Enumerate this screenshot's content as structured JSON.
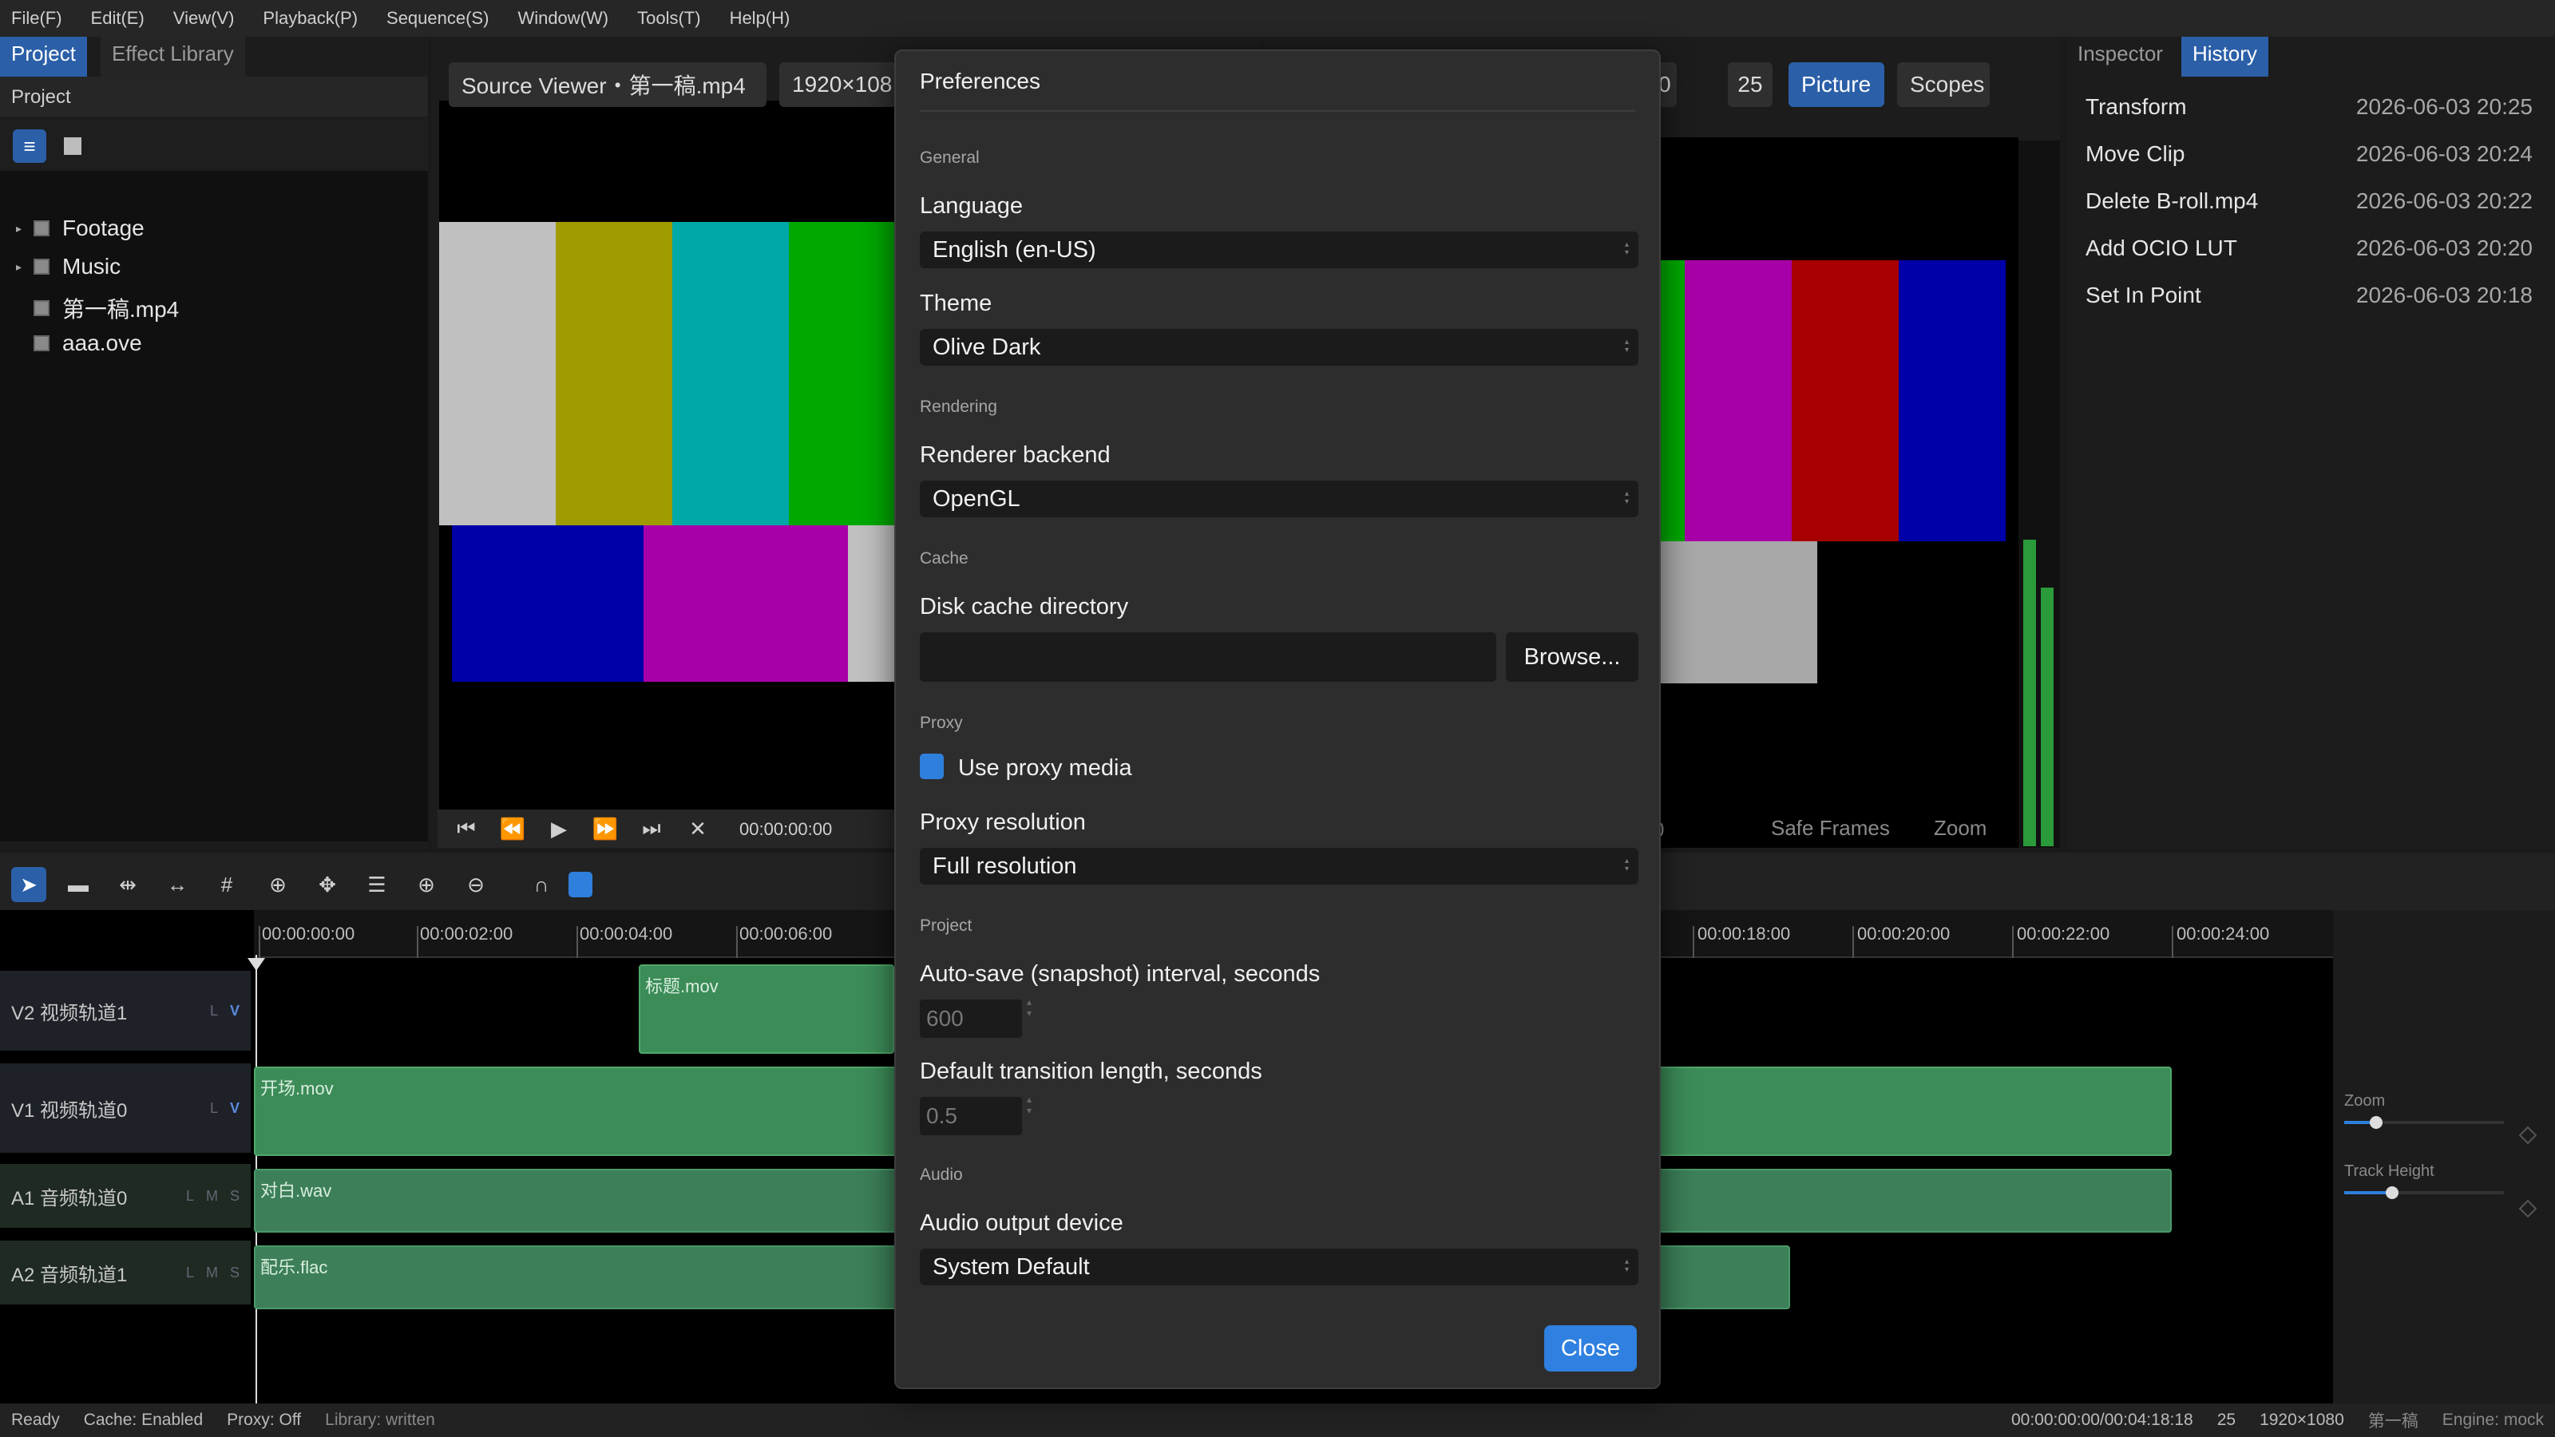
{
  "menu": [
    "File(F)",
    "Edit(E)",
    "View(V)",
    "Playback(P)",
    "Sequence(S)",
    "Window(W)",
    "Tools(T)",
    "Help(H)"
  ],
  "left_panel": {
    "tabs": [
      "Project",
      "Effect Library"
    ],
    "title": "Project",
    "items": [
      {
        "label": "Footage",
        "expandable": true
      },
      {
        "label": "Music",
        "expandable": true
      },
      {
        "label": "第一稿.mp4",
        "expandable": false
      },
      {
        "label": "aaa.ove",
        "expandable": false
      }
    ]
  },
  "source_viewer": {
    "title": "Source Viewer・第一稿.mp4",
    "resolution": "1920×108",
    "timecode": "00:00:00:00"
  },
  "program_viewer": {
    "res_tail": "080",
    "fps": "25",
    "picture_label": "Picture",
    "scopes_label": "Scopes",
    "tc_tail": "0",
    "safe_frames_label": "Safe Frames",
    "zoom_label": "Zoom"
  },
  "right_panel": {
    "tabs": [
      "Inspector",
      "History"
    ],
    "history": [
      {
        "action": "Transform",
        "time": "2026-06-03 20:25"
      },
      {
        "action": "Move Clip",
        "time": "2026-06-03 20:24"
      },
      {
        "action": "Delete B-roll.mp4",
        "time": "2026-06-03 20:22"
      },
      {
        "action": "Add OCIO LUT",
        "time": "2026-06-03 20:20"
      },
      {
        "action": "Set In Point",
        "time": "2026-06-03 20:18"
      }
    ]
  },
  "timeline": {
    "ruler": [
      "00:00:00:00",
      "00:00:02:00",
      "00:00:04:00",
      "00:00:06:00",
      "00:00:18:00",
      "00:00:20:00",
      "00:00:22:00",
      "00:00:24:00"
    ],
    "tracks": [
      {
        "name": "V2 视频轨道1",
        "flags": [
          "L",
          "V"
        ]
      },
      {
        "name": "V1 视频轨道0",
        "flags": [
          "L",
          "V"
        ]
      },
      {
        "name": "A1 音频轨道0",
        "flags": [
          "L",
          "M",
          "S"
        ]
      },
      {
        "name": "A2 音频轨道1",
        "flags": [
          "L",
          "M",
          "S"
        ]
      }
    ],
    "clips": [
      "标题.mov",
      "开场.mov",
      "对白.wav",
      "配乐.flac"
    ],
    "zoom_label": "Zoom",
    "track_height_label": "Track Height",
    "zoom_level": 0.2,
    "track_height_level": 0.3
  },
  "dialog": {
    "title": "Preferences",
    "sections": {
      "general": "General",
      "rendering": "Rendering",
      "cache": "Cache",
      "proxy": "Proxy",
      "project": "Project",
      "audio": "Audio"
    },
    "language_label": "Language",
    "language_value": "English (en-US)",
    "theme_label": "Theme",
    "theme_value": "Olive Dark",
    "renderer_label": "Renderer backend",
    "renderer_value": "OpenGL",
    "disk_cache_label": "Disk cache directory",
    "disk_cache_value": "",
    "browse_label": "Browse...",
    "use_proxy_label": "Use proxy media",
    "use_proxy_checked": true,
    "proxy_res_label": "Proxy resolution",
    "proxy_res_value": "Full resolution",
    "autosave_label": "Auto-save (snapshot) interval, seconds",
    "autosave_value": "600",
    "transition_label": "Default transition length, seconds",
    "transition_value": "0.5",
    "audio_device_label": "Audio output device",
    "audio_device_value": "System Default",
    "close_label": "Close"
  },
  "status": {
    "left": [
      "Ready",
      "Cache: Enabled",
      "Proxy: Off",
      "Library: written"
    ],
    "right": [
      "00:00:00:00/00:04:18:18",
      "25",
      "1920×1080",
      "第一稿",
      "Engine: mock"
    ]
  },
  "colors": {
    "accent": "#2f80e0",
    "clip": "#3c8c58",
    "dialog_bg": "#2d2d2d"
  }
}
